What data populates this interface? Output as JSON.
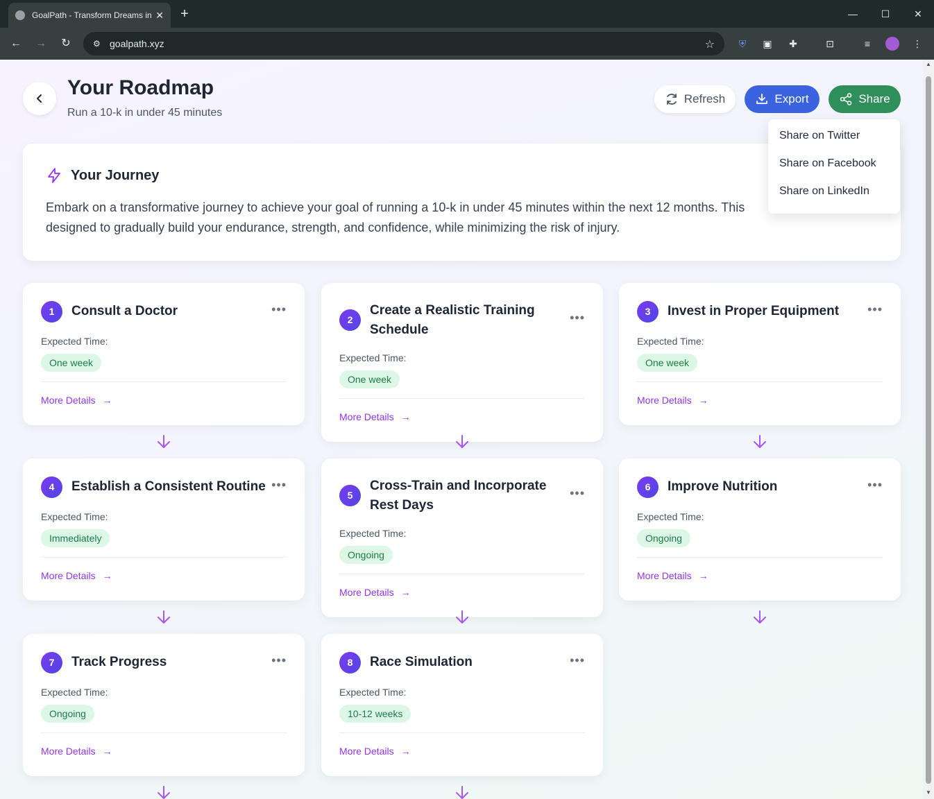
{
  "browser": {
    "tab_title": "GoalPath - Transform Dreams into Reality",
    "tab_close": "✕",
    "new_tab": "+",
    "url": "goalpath.xyz",
    "window_controls": {
      "minimize": "—",
      "maximize": "☐",
      "close": "✕"
    }
  },
  "header": {
    "title": "Your Roadmap",
    "subtitle": "Run a 10-k in under 45 minutes",
    "refresh_label": "Refresh",
    "export_label": "Export",
    "share_label": "Share"
  },
  "share_menu": {
    "items": [
      "Share on Twitter",
      "Share on Facebook",
      "Share on LinkedIn"
    ]
  },
  "journey": {
    "title": "Your Journey",
    "line1": "Embark on a transformative journey to achieve your goal of running a 10-k in under 45 minutes within the next 12 months. This",
    "line2": "designed to gradually build your endurance, strength, and confidence, while minimizing the risk of injury."
  },
  "steps": [
    {
      "num": "1",
      "title": "Consult a Doctor",
      "expected_label": "Expected Time:",
      "time": "One week",
      "more": "More Details"
    },
    {
      "num": "2",
      "title": "Create a Realistic Training Schedule",
      "expected_label": "Expected Time:",
      "time": "One week",
      "more": "More Details"
    },
    {
      "num": "3",
      "title": "Invest in Proper Equipment",
      "expected_label": "Expected Time:",
      "time": "One week",
      "more": "More Details"
    },
    {
      "num": "4",
      "title": "Establish a Consistent Routine",
      "expected_label": "Expected Time:",
      "time": "Immediately",
      "more": "More Details"
    },
    {
      "num": "5",
      "title": "Cross-Train and Incorporate Rest Days",
      "expected_label": "Expected Time:",
      "time": "Ongoing",
      "more": "More Details"
    },
    {
      "num": "6",
      "title": "Improve Nutrition",
      "expected_label": "Expected Time:",
      "time": "Ongoing",
      "more": "More Details"
    },
    {
      "num": "7",
      "title": "Track Progress",
      "expected_label": "Expected Time:",
      "time": "Ongoing",
      "more": "More Details"
    },
    {
      "num": "8",
      "title": "Race Simulation",
      "expected_label": "Expected Time:",
      "time": "10-12 weeks",
      "more": "More Details"
    }
  ],
  "colors": {
    "accent": "#7c3aed",
    "export": "#3b63e0",
    "share": "#2f8f5b",
    "badge_bg": "#dcf7e6"
  }
}
